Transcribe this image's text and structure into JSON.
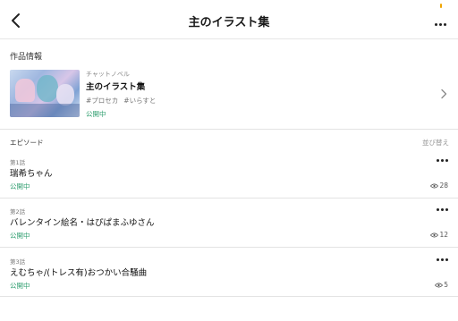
{
  "header": {
    "title": "主のイラスト集"
  },
  "work": {
    "section_label": "作品情報",
    "category": "チャットノベル",
    "title": "主のイラスト集",
    "tags": [
      "#プロセカ",
      "#いらすと"
    ],
    "status": "公開中"
  },
  "episodes": {
    "section_label": "エピソード",
    "sort_label": "並び替え",
    "items": [
      {
        "number": "第1話",
        "title": "瑞希ちゃん",
        "status": "公開中",
        "views": "28"
      },
      {
        "number": "第2話",
        "title": "バレンタイン絵名・はぴぱまふゆさん",
        "status": "公開中",
        "views": "12"
      },
      {
        "number": "第3話",
        "title": "えむちゃ/(トレス有)おつかい合騒曲",
        "status": "公開中",
        "views": "5"
      }
    ]
  },
  "icons": {
    "back": "chevron-left-icon",
    "more": "more-horizontal-icon",
    "open": "chevron-right-icon",
    "views": "eye-icon"
  },
  "colors": {
    "status_green": "#2f9e6f",
    "notification": "#f0a500"
  }
}
